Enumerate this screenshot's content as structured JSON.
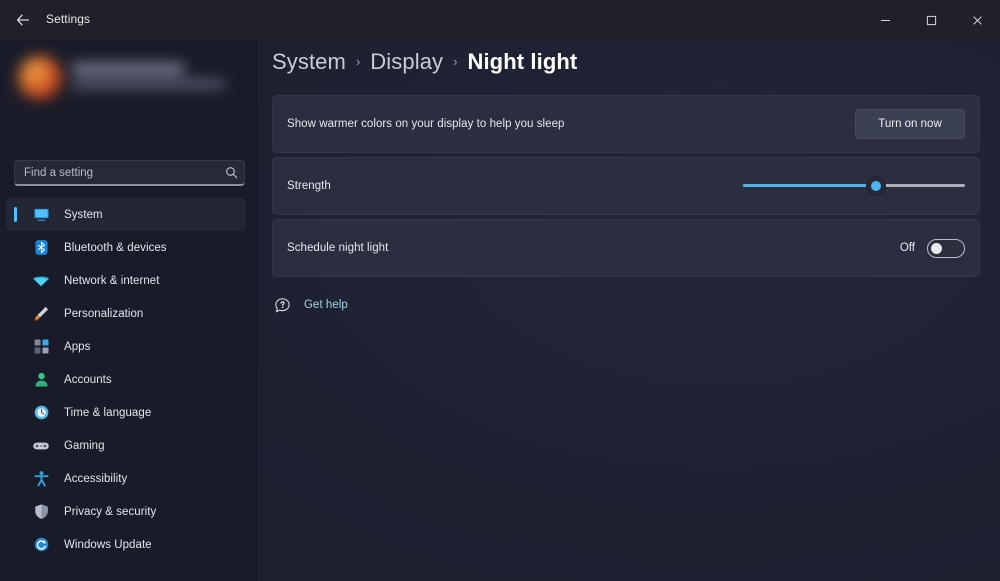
{
  "window": {
    "app_title": "Settings",
    "back_icon": "back-arrow-icon",
    "controls": {
      "minimize": "–",
      "maximize": "❐",
      "close": "✕"
    }
  },
  "sidebar": {
    "profile": {
      "name_redacted": "",
      "email_redacted": ""
    },
    "search": {
      "placeholder": "Find a setting",
      "value": "",
      "icon": "search-icon"
    },
    "items": [
      {
        "label": "System",
        "icon": "monitor-icon",
        "selected": true
      },
      {
        "label": "Bluetooth & devices",
        "icon": "bluetooth-icon",
        "selected": false
      },
      {
        "label": "Network & internet",
        "icon": "wifi-icon",
        "selected": false
      },
      {
        "label": "Personalization",
        "icon": "paintbrush-icon",
        "selected": false
      },
      {
        "label": "Apps",
        "icon": "apps-grid-icon",
        "selected": false
      },
      {
        "label": "Accounts",
        "icon": "person-icon",
        "selected": false
      },
      {
        "label": "Time & language",
        "icon": "clock-globe-icon",
        "selected": false
      },
      {
        "label": "Gaming",
        "icon": "game-controller-icon",
        "selected": false
      },
      {
        "label": "Accessibility",
        "icon": "accessibility-icon",
        "selected": false
      },
      {
        "label": "Privacy & security",
        "icon": "shield-icon",
        "selected": false
      },
      {
        "label": "Windows Update",
        "icon": "update-refresh-icon",
        "selected": false
      }
    ]
  },
  "main": {
    "breadcrumb": {
      "root": "System",
      "parent": "Display",
      "current": "Night light",
      "separator": "›"
    },
    "cards": {
      "night_light": {
        "label": "Show warmer colors on your display to help you sleep",
        "button_label": "Turn on now"
      },
      "strength": {
        "label": "Strength",
        "value_percent": 60
      },
      "schedule": {
        "label": "Schedule night light",
        "state_label": "Off",
        "state_on": false
      }
    },
    "get_help": {
      "label": "Get help",
      "icon": "help-question-bubble-icon"
    }
  },
  "colors": {
    "accent": "#4cc2ff",
    "slider_fill": "#4cb4f0",
    "card_bg": "#2a2e3e",
    "sidebar_bg": "#191c28",
    "link": "#9fd4e8"
  }
}
